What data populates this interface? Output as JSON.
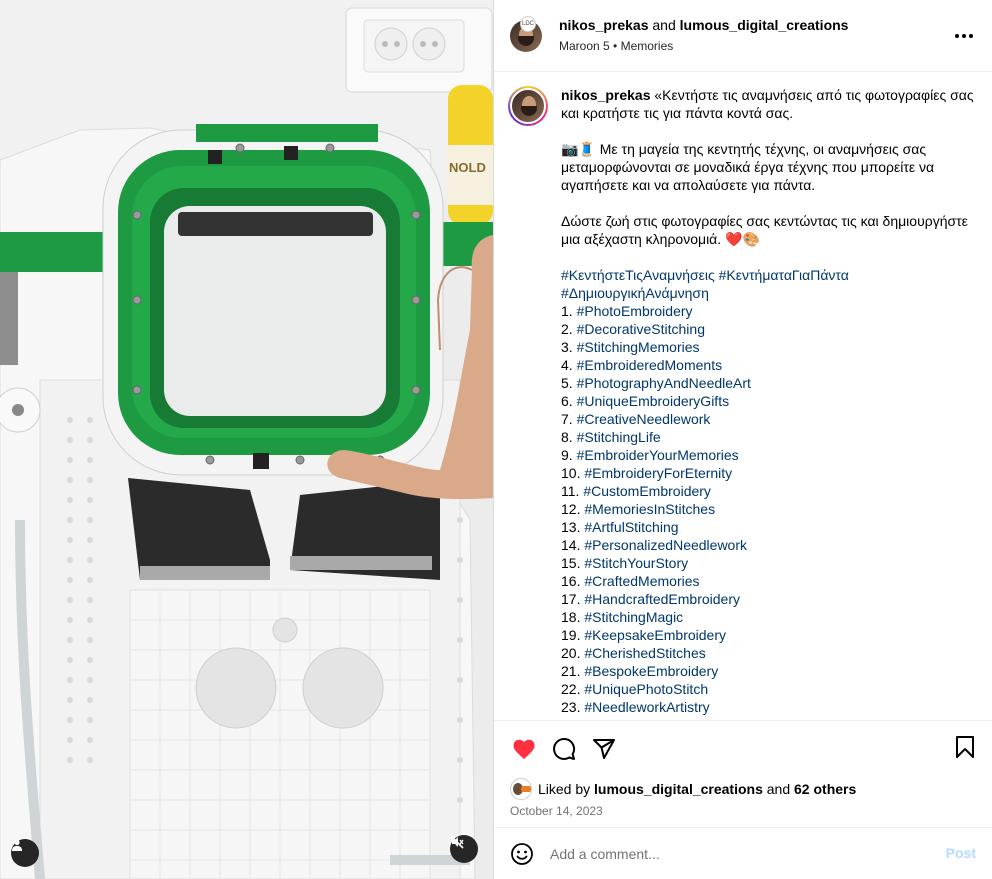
{
  "header": {
    "author": "nikos_prekas",
    "joiner": "and",
    "coauthor": "lumous_digital_creations",
    "music": "Maroon 5",
    "separator": "•",
    "song": "Memories",
    "more_icon": "more-horizontal-icon"
  },
  "caption": {
    "username": "nikos_prekas",
    "intro": "«Κεντήστε τις αναμνήσεις από τις φωτογραφίες σας και κρατήστε τις για πάντα κοντά σας.",
    "para2": "📷🧵 Με τη μαγεία της κεντητής τέχνης, οι αναμνήσεις σας μεταμορφώνονται σε μοναδικά έργα τέχνης που μπορείτε να αγαπήσετε και να απολαύσετε για πάντα.",
    "para3": "Δώστε ζωή στις φωτογραφίες σας κεντώντας τις και δημιουργήστε μια αξέχαστη κληρονομιά. ❤️🎨",
    "lead_tags": "#ΚεντήστεΤιςΑναμνήσεις #ΚεντήματαΓιαΠάντα #ΔημιουργικήΑνάμνηση",
    "list": [
      {
        "n": "1.",
        "tag": "#PhotoEmbroidery"
      },
      {
        "n": "2.",
        "tag": "#DecorativeStitching"
      },
      {
        "n": "3.",
        "tag": "#StitchingMemories"
      },
      {
        "n": "4.",
        "tag": "#EmbroideredMoments"
      },
      {
        "n": "5.",
        "tag": "#PhotographyAndNeedleArt"
      },
      {
        "n": "6.",
        "tag": "#UniqueEmbroideryGifts"
      },
      {
        "n": "7.",
        "tag": "#CreativeNeedlework"
      },
      {
        "n": "8.",
        "tag": "#StitchingLife"
      },
      {
        "n": "9.",
        "tag": "#EmbroiderYourMemories"
      },
      {
        "n": "10.",
        "tag": "#EmbroideryForEternity"
      },
      {
        "n": "11.",
        "tag": "#CustomEmbroidery"
      },
      {
        "n": "12.",
        "tag": "#MemoriesInStitches"
      },
      {
        "n": "13.",
        "tag": "#ArtfulStitching"
      },
      {
        "n": "14.",
        "tag": "#PersonalizedNeedlework"
      },
      {
        "n": "15.",
        "tag": "#StitchYourStory"
      },
      {
        "n": "16.",
        "tag": "#CraftedMemories"
      },
      {
        "n": "17.",
        "tag": "#HandcraftedEmbroidery"
      },
      {
        "n": "18.",
        "tag": "#StitchingMagic"
      },
      {
        "n": "19.",
        "tag": "#KeepsakeEmbroidery"
      },
      {
        "n": "20.",
        "tag": "#CherishedStitches"
      },
      {
        "n": "21.",
        "tag": "#BespokeEmbroidery"
      },
      {
        "n": "22.",
        "tag": "#UniquePhotoStitch"
      },
      {
        "n": "23.",
        "tag": "#NeedleworkArtistry"
      }
    ]
  },
  "actions": {
    "liked": true,
    "like_color": "#ff3040",
    "icons": [
      "heart-icon",
      "comment-icon",
      "share-icon",
      "bookmark-icon"
    ]
  },
  "likes": {
    "prefix": "Liked by",
    "user": "lumous_digital_creations",
    "joiner": "and",
    "others": "62 others"
  },
  "date": "October 14, 2023",
  "comment": {
    "placeholder": "Add a comment...",
    "post_label": "Post"
  },
  "media": {
    "hoop_color": "#1e9a43",
    "user_icon": "user-tag-icon",
    "mute_icon": "muted-speaker-icon"
  }
}
